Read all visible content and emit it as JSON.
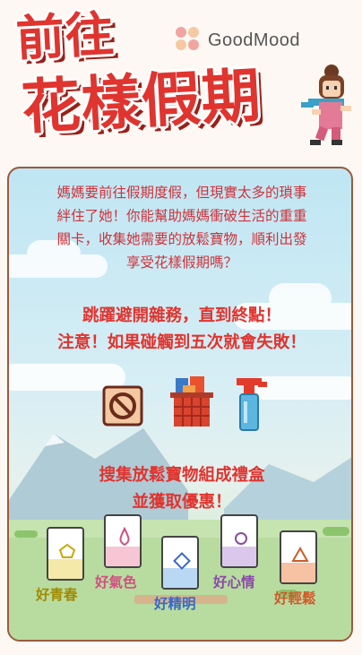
{
  "header": {
    "title_line1": "前往",
    "title_line2": "花樣假期",
    "brand": "GoodMood"
  },
  "intro": {
    "line1": "媽媽要前往假期度假，但現實太多的瑣事",
    "line2": "絆住了她！你能幫助媽媽衝破生活的重重",
    "line3": "關卡，收集她需要的放鬆寶物，順利出發",
    "line4": "享受花樣假期嗎？"
  },
  "rules": {
    "line1": "跳躍避開雜務，直到終點！",
    "line2": "注意！如果碰觸到五次就會失敗！"
  },
  "collect": {
    "line1": "搜集放鬆寶物組成禮盒",
    "line2": "並獲取優惠！"
  },
  "cards": [
    {
      "label": "好青春",
      "color": "#a08a00",
      "fill": "#f4e9a8"
    },
    {
      "label": "好氣色",
      "color": "#d05080",
      "fill": "#f7c6d4"
    },
    {
      "label": "好精明",
      "color": "#3a68c8",
      "fill": "#b9d8f3"
    },
    {
      "label": "好心情",
      "color": "#8a4aa8",
      "fill": "#dcc7ec"
    },
    {
      "label": "好輕鬆",
      "color": "#d05a2a",
      "fill": "#f6c2a3"
    }
  ],
  "colors": {
    "title_red": "#e0342f",
    "text_red": "#d0323a",
    "panel_border": "#9a5a3c"
  }
}
